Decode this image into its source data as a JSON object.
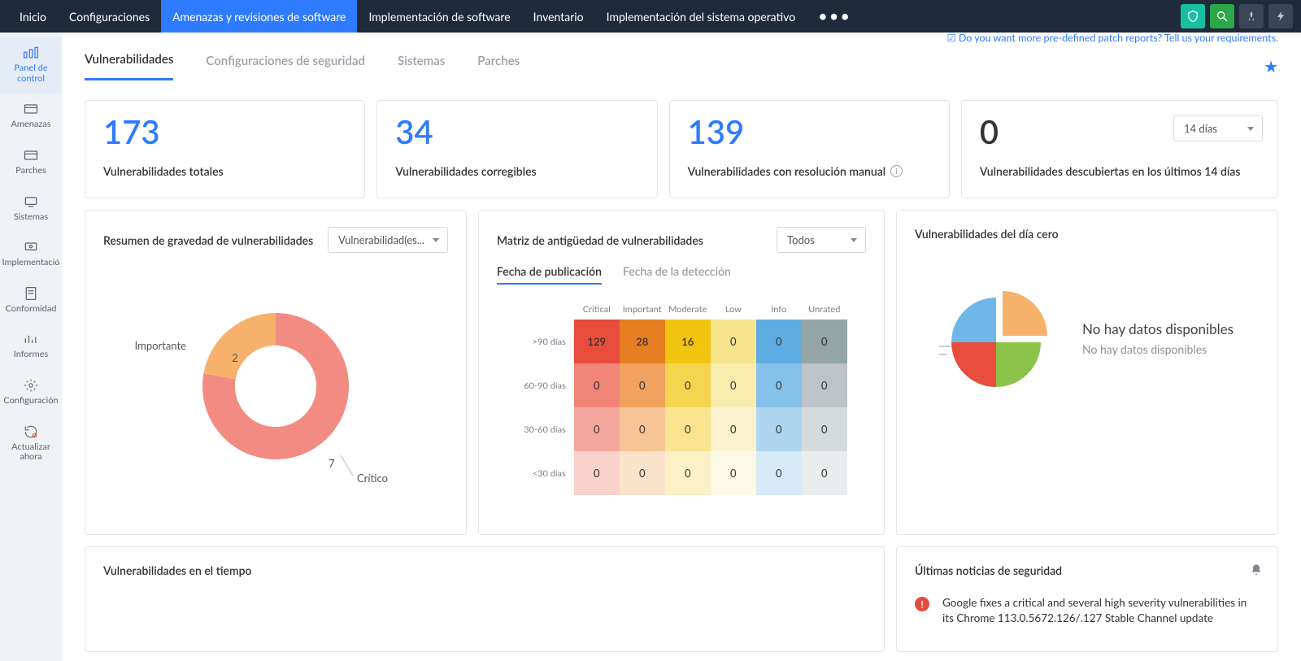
{
  "topnav": {
    "items": [
      "Inicio",
      "Configuraciones",
      "Amenazas y revisiones de software",
      "Implementación de software",
      "Inventario",
      "Implementación del sistema operativo"
    ],
    "active_index": 2
  },
  "sidebar": {
    "items": [
      {
        "key": "panel",
        "label": "Panel de control"
      },
      {
        "key": "amenazas",
        "label": "Amenazas"
      },
      {
        "key": "parches",
        "label": "Parches"
      },
      {
        "key": "sistemas",
        "label": "Sistemas"
      },
      {
        "key": "implement",
        "label": "Implementació"
      },
      {
        "key": "conform",
        "label": "Conformidad"
      },
      {
        "key": "informes",
        "label": "Informes"
      },
      {
        "key": "config",
        "label": "Configuración"
      },
      {
        "key": "actualizar",
        "label": "Actualizar ahora"
      }
    ],
    "active_index": 0
  },
  "promo_link": "Do you want more pre-defined patch reports? Tell us your requirements.",
  "sub_tabs": {
    "items": [
      "Vulnerabilidades",
      "Configuraciones de seguridad",
      "Sistemas",
      "Parches"
    ],
    "active_index": 0
  },
  "stats": {
    "total": {
      "value": "173",
      "label": "Vulnerabilidades totales"
    },
    "fixable": {
      "value": "34",
      "label": "Vulnerabilidades corregibles"
    },
    "manual": {
      "value": "139",
      "label": "Vulnerabilidades con resolución manual"
    },
    "recent": {
      "value": "0",
      "label": "Vulnerabilidades descubiertas en los últimos 14 días",
      "days_selected": "14 días"
    }
  },
  "severity_panel": {
    "title": "Resumen de gravedad de vulnerabilidades",
    "dropdown": "Vulnerabilidad(es...",
    "labels": {
      "importante": "Importante",
      "critico": "Crítico"
    }
  },
  "chart_data": {
    "type": "pie",
    "title": "Resumen de gravedad de vulnerabilidades",
    "series": [
      {
        "name": "Crítico",
        "value": 7,
        "color": "#f28b82"
      },
      {
        "name": "Importante",
        "value": 2,
        "color": "#f6b26b"
      }
    ]
  },
  "matrix_panel": {
    "title": "Matriz de antigüedad de vulnerabilidades",
    "dropdown": "Todos",
    "subtabs": [
      "Fecha de publicación",
      "Fecha de la detección"
    ],
    "subtab_active": 0,
    "columns": [
      "Critical",
      "Important",
      "Moderate",
      "Low",
      "Info",
      "Unrated"
    ],
    "rows": [
      ">90 días",
      "60-90 días",
      "30-60 días",
      "<30 días"
    ],
    "cells": [
      [
        129,
        28,
        16,
        0,
        0,
        0
      ],
      [
        0,
        0,
        0,
        0,
        0,
        0
      ],
      [
        0,
        0,
        0,
        0,
        0,
        0
      ],
      [
        0,
        0,
        0,
        0,
        0,
        0
      ]
    ]
  },
  "zeroday_panel": {
    "title": "Vulnerabilidades del día cero",
    "msg1": "No hay datos disponibles",
    "msg2": "No hay datos disponibles"
  },
  "trend_panel": {
    "title": "Vulnerabilidades en el tiempo"
  },
  "news_panel": {
    "title": "Últimas noticias de seguridad",
    "item": "Google fixes a critical and several high severity vulnerabilities in its Chrome 113.0.5672.126/.127 Stable Channel update"
  }
}
